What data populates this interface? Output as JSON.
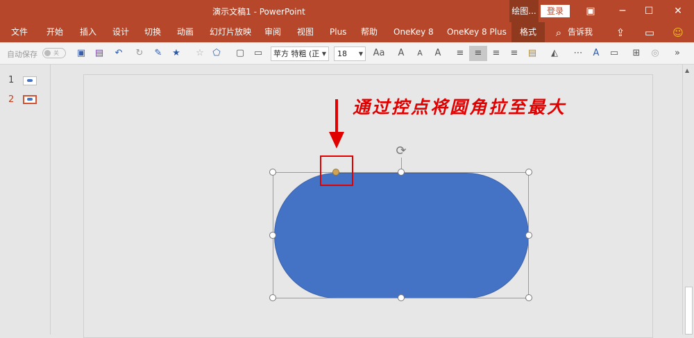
{
  "titlebar": {
    "title": "演示文稿1  -  PowerPoint",
    "context_label": "绘图...",
    "login_label": "登录",
    "buttons": {
      "ribbon_display": "▣",
      "minimize": "─",
      "maximize": "☐",
      "close": "✕"
    }
  },
  "ribbon": {
    "tabs": [
      "文件",
      "开始",
      "插入",
      "设计",
      "切换",
      "动画",
      "幻灯片放映",
      "审阅",
      "视图",
      "Plus",
      "帮助",
      "OneKey 8",
      "OneKey 8 Plus",
      "格式"
    ],
    "active_tab": "格式",
    "tell_me": "告诉我",
    "icons": {
      "search": "⌕",
      "share": "⇪",
      "comment": "▭",
      "smiley": "☺"
    }
  },
  "toolbar": {
    "autosave_label": "自动保存",
    "toggle_text": "关",
    "font_name": "苹方 特粗 (正",
    "font_size": "18",
    "font_size_label": "Aa",
    "icons": {
      "save_as": "▣",
      "save": "▤",
      "undo": "↶",
      "redo": "↻",
      "format_painter": "✎",
      "star": "★",
      "star_outline": "☆",
      "shapes": "⬠",
      "screenshot": "▢",
      "textbox": "▭",
      "grow_font": "A",
      "shrink_font": "A",
      "clear_format": "A",
      "font_color": "A",
      "align_left": "≡",
      "align_center": "≡",
      "align_right": "≡",
      "justify": "≡",
      "paste": "▤",
      "triangle": "◭",
      "dots": "⋯",
      "text_effect": "A",
      "textbox2": "▭",
      "arrange": "⊞",
      "shapes2": "◎",
      "more": "»"
    }
  },
  "slides_panel": {
    "slides": [
      {
        "number": "1",
        "selected": false
      },
      {
        "number": "2",
        "selected": true
      }
    ]
  },
  "slide": {
    "annotation": "通过控点将圆角拉至最大",
    "shape_color": "#4472c4",
    "accent_red": "#e00000"
  },
  "colors": {
    "brand": "#b7472a",
    "brand_dark": "#8f3a1f"
  }
}
